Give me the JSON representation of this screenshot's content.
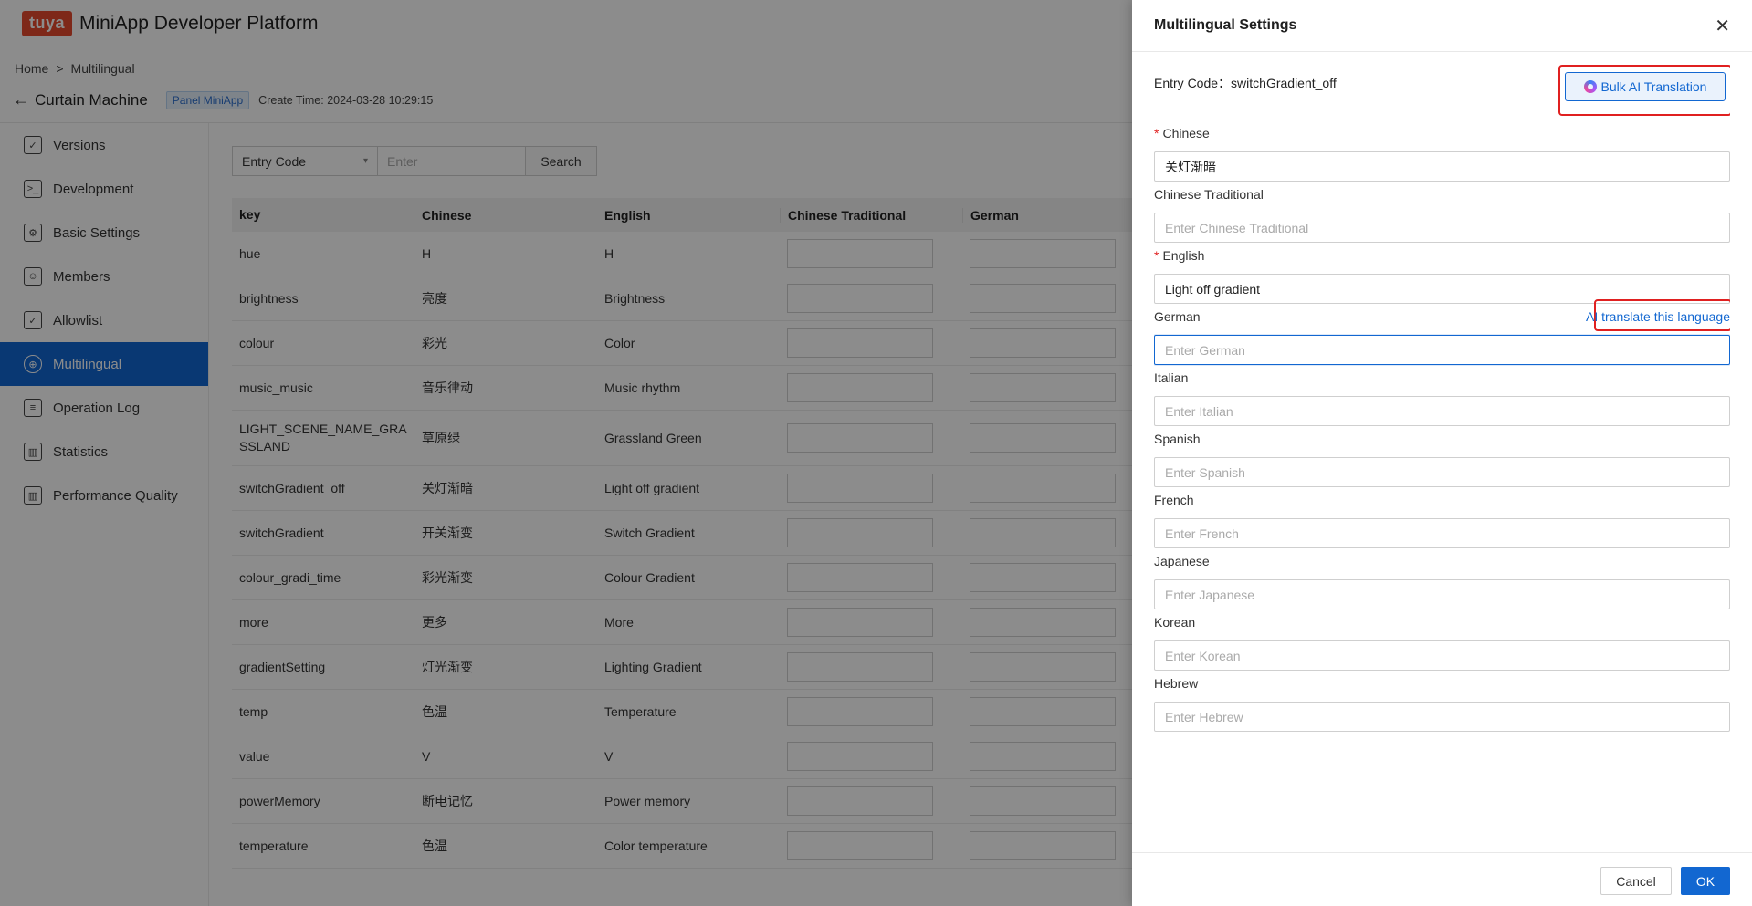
{
  "header": {
    "logo_text": "tuya",
    "platform_title": "MiniApp Developer Platform"
  },
  "breadcrumb": {
    "home": "Home",
    "separator": ">",
    "current": "Multilingual"
  },
  "project": {
    "name": "Curtain Machine",
    "tag": "Panel MiniApp",
    "create_time": "Create Time: 2024-03-28 10:29:15"
  },
  "sidebar": {
    "items": [
      {
        "label": "Versions",
        "icon": "versions-icon",
        "glyph": "✓"
      },
      {
        "label": "Development",
        "icon": "development-icon",
        "glyph": ">_"
      },
      {
        "label": "Basic Settings",
        "icon": "gear-icon",
        "glyph": "⚙"
      },
      {
        "label": "Members",
        "icon": "members-icon",
        "glyph": "☺"
      },
      {
        "label": "Allowlist",
        "icon": "allowlist-icon",
        "glyph": "✓"
      },
      {
        "label": "Multilingual",
        "icon": "globe-icon",
        "glyph": "⊕",
        "active": true
      },
      {
        "label": "Operation Log",
        "icon": "log-icon",
        "glyph": "≡"
      },
      {
        "label": "Statistics",
        "icon": "statistics-icon",
        "glyph": "▥"
      },
      {
        "label": "Performance Quality",
        "icon": "performance-icon",
        "glyph": "▥"
      }
    ]
  },
  "filter": {
    "select_value": "Entry Code",
    "input_placeholder": "Enter",
    "search_label": "Search"
  },
  "table": {
    "columns": [
      "key",
      "Chinese",
      "English",
      "Chinese Traditional",
      "German"
    ],
    "rows": [
      {
        "key": "hue",
        "zh": "H",
        "en": "H"
      },
      {
        "key": "brightness",
        "zh": "亮度",
        "en": "Brightness"
      },
      {
        "key": "colour",
        "zh": "彩光",
        "en": "Color"
      },
      {
        "key": "music_music",
        "zh": "音乐律动",
        "en": "Music rhythm"
      },
      {
        "key": "LIGHT_SCENE_NAME_GRASSLAND",
        "zh": "草原绿",
        "en": "Grassland Green"
      },
      {
        "key": "switchGradient_off",
        "zh": "关灯渐暗",
        "en": "Light off gradient"
      },
      {
        "key": "switchGradient",
        "zh": "开关渐变",
        "en": "Switch Gradient"
      },
      {
        "key": "colour_gradi_time",
        "zh": "彩光渐变",
        "en": "Colour Gradient"
      },
      {
        "key": "more",
        "zh": "更多",
        "en": "More"
      },
      {
        "key": "gradientSetting",
        "zh": "灯光渐变",
        "en": "Lighting Gradient"
      },
      {
        "key": "temp",
        "zh": "色温",
        "en": "Temperature"
      },
      {
        "key": "value",
        "zh": "V",
        "en": "V"
      },
      {
        "key": "powerMemory",
        "zh": "断电记忆",
        "en": "Power memory"
      },
      {
        "key": "temperature",
        "zh": "色温",
        "en": "Color temperature"
      }
    ]
  },
  "drawer": {
    "title": "Multilingual Settings",
    "close_icon": "✕",
    "entry_code_label": "Entry Code：",
    "entry_code_value": "switchGradient_off",
    "bulk_ai_label": "Bulk AI Translation",
    "ai_translate_label": "AI translate this language",
    "fields": {
      "chinese": {
        "label": "Chinese",
        "value": "关灯渐暗"
      },
      "chinese_traditional": {
        "label": "Chinese Traditional",
        "placeholder": "Enter Chinese Traditional"
      },
      "english": {
        "label": "English",
        "value": "Light off gradient"
      },
      "german": {
        "label": "German",
        "placeholder": "Enter German"
      },
      "italian": {
        "label": "Italian",
        "placeholder": "Enter Italian"
      },
      "spanish": {
        "label": "Spanish",
        "placeholder": "Enter Spanish"
      },
      "french": {
        "label": "French",
        "placeholder": "Enter French"
      },
      "japanese": {
        "label": "Japanese",
        "placeholder": "Enter Japanese"
      },
      "korean": {
        "label": "Korean",
        "placeholder": "Enter Korean"
      },
      "hebrew": {
        "label": "Hebrew",
        "placeholder": "Enter Hebrew"
      }
    },
    "cancel_label": "Cancel",
    "ok_label": "OK"
  }
}
